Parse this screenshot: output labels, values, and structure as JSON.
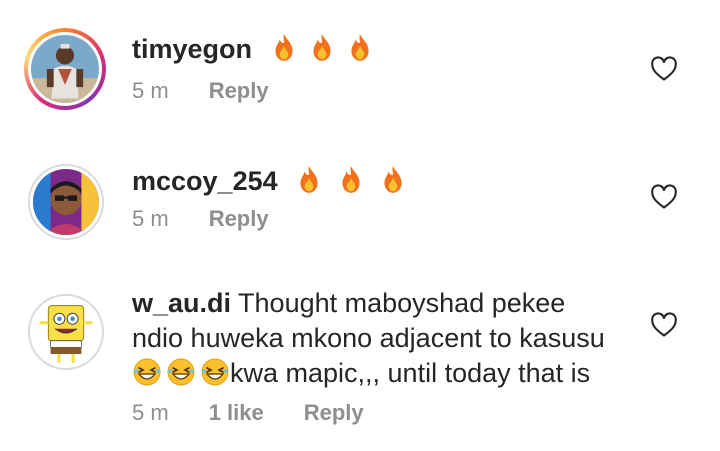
{
  "comments": [
    {
      "username": "timyegon",
      "text": "",
      "emojis": [
        "fire",
        "fire",
        "fire"
      ],
      "time": "5 m",
      "likes": "",
      "reply_label": "Reply",
      "avatar_icon": "profile-photo-man-in-vest"
    },
    {
      "username": "mccoy_254",
      "text": "",
      "emojis": [
        "fire",
        "fire",
        "fire"
      ],
      "time": "5 m",
      "likes": "",
      "reply_label": "Reply",
      "avatar_icon": "profile-photo-man-with-glasses"
    },
    {
      "username": "w_au.di",
      "text_line1": "Thought maboyshad pekee",
      "text_line2": "ndio huweka mkono adjacent to kasusu",
      "text_line3": "kwa mapic,,, until today that is",
      "emojis": [
        "laugh",
        "laugh",
        "laugh"
      ],
      "time": "5 m",
      "likes": "1 like",
      "reply_label": "Reply",
      "avatar_icon": "spongebob-avatar"
    }
  ],
  "icons": {
    "heart": "heart-outline-icon",
    "fire": "fire-emoji",
    "laugh": "grinning-squinting-emoji"
  },
  "colors": {
    "text": "#262626",
    "muted": "#8e8e8e",
    "fire": "#f2711c"
  }
}
